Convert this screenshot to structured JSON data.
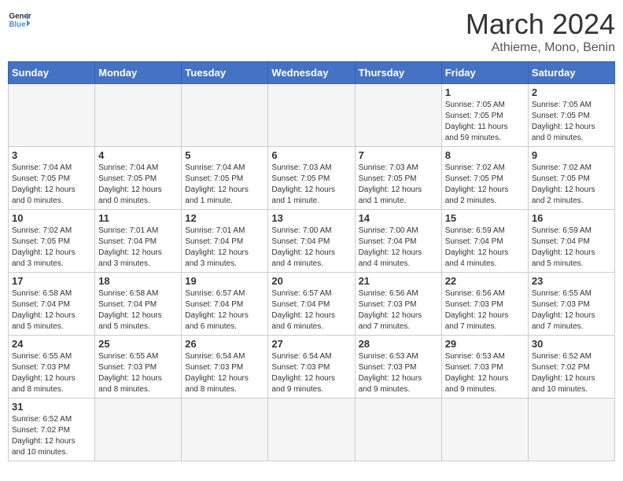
{
  "header": {
    "logo_general": "General",
    "logo_blue": "Blue",
    "month_title": "March 2024",
    "location": "Athieme, Mono, Benin"
  },
  "weekdays": [
    "Sunday",
    "Monday",
    "Tuesday",
    "Wednesday",
    "Thursday",
    "Friday",
    "Saturday"
  ],
  "weeks": [
    {
      "days": [
        {
          "num": "",
          "info": "",
          "empty": true
        },
        {
          "num": "",
          "info": "",
          "empty": true
        },
        {
          "num": "",
          "info": "",
          "empty": true
        },
        {
          "num": "",
          "info": "",
          "empty": true
        },
        {
          "num": "",
          "info": "",
          "empty": true
        },
        {
          "num": "1",
          "info": "Sunrise: 7:05 AM\nSunset: 7:05 PM\nDaylight: 11 hours\nand 59 minutes.",
          "empty": false
        },
        {
          "num": "2",
          "info": "Sunrise: 7:05 AM\nSunset: 7:05 PM\nDaylight: 12 hours\nand 0 minutes.",
          "empty": false
        }
      ]
    },
    {
      "days": [
        {
          "num": "3",
          "info": "Sunrise: 7:04 AM\nSunset: 7:05 PM\nDaylight: 12 hours\nand 0 minutes.",
          "empty": false
        },
        {
          "num": "4",
          "info": "Sunrise: 7:04 AM\nSunset: 7:05 PM\nDaylight: 12 hours\nand 0 minutes.",
          "empty": false
        },
        {
          "num": "5",
          "info": "Sunrise: 7:04 AM\nSunset: 7:05 PM\nDaylight: 12 hours\nand 1 minute.",
          "empty": false
        },
        {
          "num": "6",
          "info": "Sunrise: 7:03 AM\nSunset: 7:05 PM\nDaylight: 12 hours\nand 1 minute.",
          "empty": false
        },
        {
          "num": "7",
          "info": "Sunrise: 7:03 AM\nSunset: 7:05 PM\nDaylight: 12 hours\nand 1 minute.",
          "empty": false
        },
        {
          "num": "8",
          "info": "Sunrise: 7:02 AM\nSunset: 7:05 PM\nDaylight: 12 hours\nand 2 minutes.",
          "empty": false
        },
        {
          "num": "9",
          "info": "Sunrise: 7:02 AM\nSunset: 7:05 PM\nDaylight: 12 hours\nand 2 minutes.",
          "empty": false
        }
      ]
    },
    {
      "days": [
        {
          "num": "10",
          "info": "Sunrise: 7:02 AM\nSunset: 7:05 PM\nDaylight: 12 hours\nand 3 minutes.",
          "empty": false
        },
        {
          "num": "11",
          "info": "Sunrise: 7:01 AM\nSunset: 7:04 PM\nDaylight: 12 hours\nand 3 minutes.",
          "empty": false
        },
        {
          "num": "12",
          "info": "Sunrise: 7:01 AM\nSunset: 7:04 PM\nDaylight: 12 hours\nand 3 minutes.",
          "empty": false
        },
        {
          "num": "13",
          "info": "Sunrise: 7:00 AM\nSunset: 7:04 PM\nDaylight: 12 hours\nand 4 minutes.",
          "empty": false
        },
        {
          "num": "14",
          "info": "Sunrise: 7:00 AM\nSunset: 7:04 PM\nDaylight: 12 hours\nand 4 minutes.",
          "empty": false
        },
        {
          "num": "15",
          "info": "Sunrise: 6:59 AM\nSunset: 7:04 PM\nDaylight: 12 hours\nand 4 minutes.",
          "empty": false
        },
        {
          "num": "16",
          "info": "Sunrise: 6:59 AM\nSunset: 7:04 PM\nDaylight: 12 hours\nand 5 minutes.",
          "empty": false
        }
      ]
    },
    {
      "days": [
        {
          "num": "17",
          "info": "Sunrise: 6:58 AM\nSunset: 7:04 PM\nDaylight: 12 hours\nand 5 minutes.",
          "empty": false
        },
        {
          "num": "18",
          "info": "Sunrise: 6:58 AM\nSunset: 7:04 PM\nDaylight: 12 hours\nand 5 minutes.",
          "empty": false
        },
        {
          "num": "19",
          "info": "Sunrise: 6:57 AM\nSunset: 7:04 PM\nDaylight: 12 hours\nand 6 minutes.",
          "empty": false
        },
        {
          "num": "20",
          "info": "Sunrise: 6:57 AM\nSunset: 7:04 PM\nDaylight: 12 hours\nand 6 minutes.",
          "empty": false
        },
        {
          "num": "21",
          "info": "Sunrise: 6:56 AM\nSunset: 7:03 PM\nDaylight: 12 hours\nand 7 minutes.",
          "empty": false
        },
        {
          "num": "22",
          "info": "Sunrise: 6:56 AM\nSunset: 7:03 PM\nDaylight: 12 hours\nand 7 minutes.",
          "empty": false
        },
        {
          "num": "23",
          "info": "Sunrise: 6:55 AM\nSunset: 7:03 PM\nDaylight: 12 hours\nand 7 minutes.",
          "empty": false
        }
      ]
    },
    {
      "days": [
        {
          "num": "24",
          "info": "Sunrise: 6:55 AM\nSunset: 7:03 PM\nDaylight: 12 hours\nand 8 minutes.",
          "empty": false
        },
        {
          "num": "25",
          "info": "Sunrise: 6:55 AM\nSunset: 7:03 PM\nDaylight: 12 hours\nand 8 minutes.",
          "empty": false
        },
        {
          "num": "26",
          "info": "Sunrise: 6:54 AM\nSunset: 7:03 PM\nDaylight: 12 hours\nand 8 minutes.",
          "empty": false
        },
        {
          "num": "27",
          "info": "Sunrise: 6:54 AM\nSunset: 7:03 PM\nDaylight: 12 hours\nand 9 minutes.",
          "empty": false
        },
        {
          "num": "28",
          "info": "Sunrise: 6:53 AM\nSunset: 7:03 PM\nDaylight: 12 hours\nand 9 minutes.",
          "empty": false
        },
        {
          "num": "29",
          "info": "Sunrise: 6:53 AM\nSunset: 7:03 PM\nDaylight: 12 hours\nand 9 minutes.",
          "empty": false
        },
        {
          "num": "30",
          "info": "Sunrise: 6:52 AM\nSunset: 7:02 PM\nDaylight: 12 hours\nand 10 minutes.",
          "empty": false
        }
      ]
    },
    {
      "days": [
        {
          "num": "31",
          "info": "Sunrise: 6:52 AM\nSunset: 7:02 PM\nDaylight: 12 hours\nand 10 minutes.",
          "empty": false
        },
        {
          "num": "",
          "info": "",
          "empty": true
        },
        {
          "num": "",
          "info": "",
          "empty": true
        },
        {
          "num": "",
          "info": "",
          "empty": true
        },
        {
          "num": "",
          "info": "",
          "empty": true
        },
        {
          "num": "",
          "info": "",
          "empty": true
        },
        {
          "num": "",
          "info": "",
          "empty": true
        }
      ]
    }
  ]
}
